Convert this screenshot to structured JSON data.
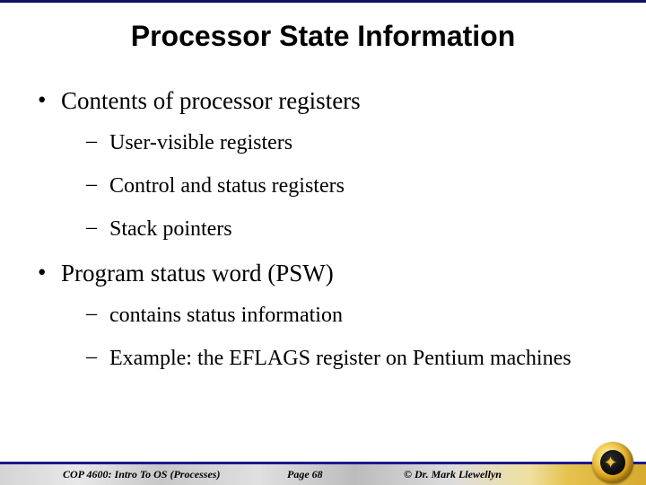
{
  "title": "Processor State Information",
  "bullets": {
    "b1": "Contents of processor registers",
    "b1a": "User-visible registers",
    "b1b": "Control and status registers",
    "b1c": "Stack pointers",
    "b2": "Program status word (PSW)",
    "b2a": "contains status information",
    "b2b": "Example: the EFLAGS register on Pentium machines"
  },
  "footer": {
    "course": "COP 4600: Intro To OS  (Processes)",
    "page": "Page 68",
    "copyright": "© Dr. Mark Llewellyn"
  }
}
